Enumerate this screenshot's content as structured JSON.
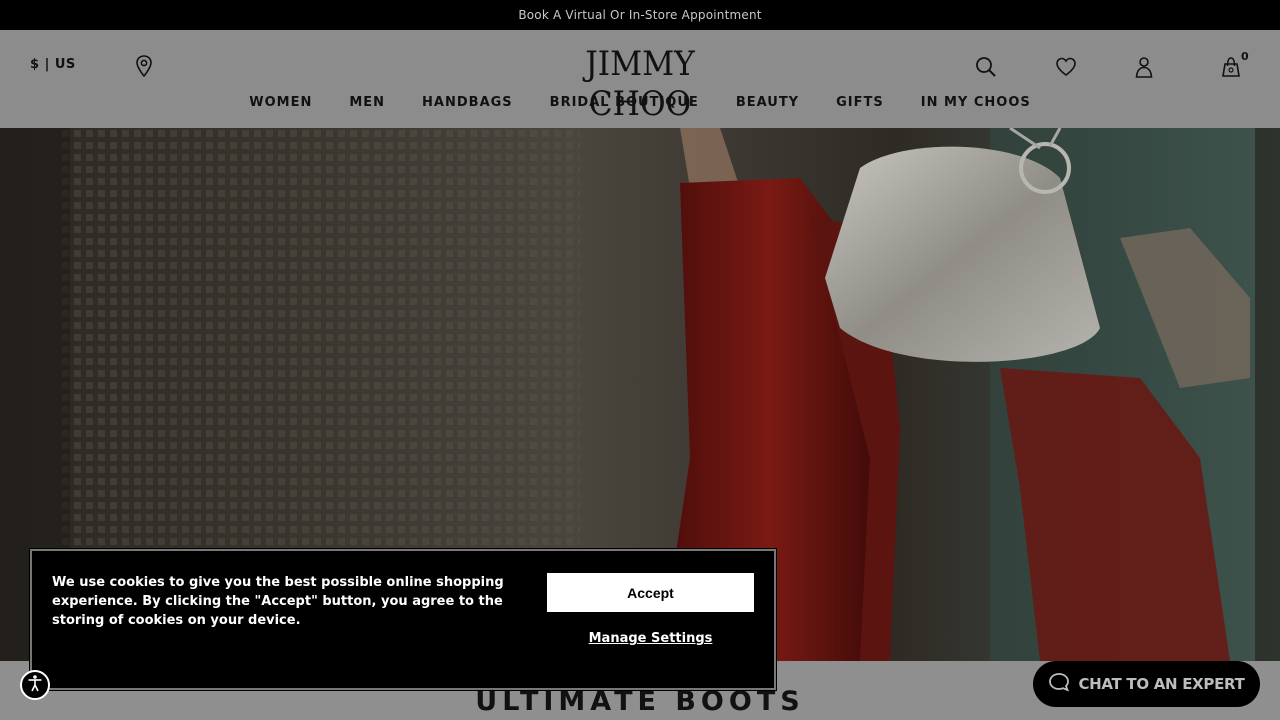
{
  "promo": {
    "text": "Book A Virtual Or In-Store Appointment"
  },
  "header": {
    "currency": "$ | US",
    "logo": "JIMMY CHOO",
    "bag_count": "0"
  },
  "nav": {
    "items": [
      "WOMEN",
      "MEN",
      "HANDBAGS",
      "BRIDAL BOUTIQUE",
      "BEAUTY",
      "GIFTS",
      "IN MY CHOOS"
    ]
  },
  "section": {
    "title": "ULTIMATE BOOTS"
  },
  "cookie": {
    "message": "We use cookies to give you the best possible online shopping experience. By clicking the \"Accept\" button, you agree to the storing of cookies on your device.",
    "accept_label": "Accept",
    "manage_label": "Manage Settings"
  },
  "chat": {
    "label": "CHAT TO AN EXPERT"
  },
  "icons": {
    "store": "store-locator-icon",
    "search": "search-icon",
    "wishlist": "heart-icon",
    "account": "account-icon",
    "bag": "shopping-bag-icon",
    "accessibility": "accessibility-icon",
    "chat": "chat-bubble-icon"
  },
  "colors": {
    "promo_bg": "#000000",
    "header_bg": "#8c8c8c",
    "cookie_bg": "#000000",
    "accept_bg": "#ffffff",
    "boot_red": "#6e1410",
    "bag_silver": "#a8a6a0"
  }
}
